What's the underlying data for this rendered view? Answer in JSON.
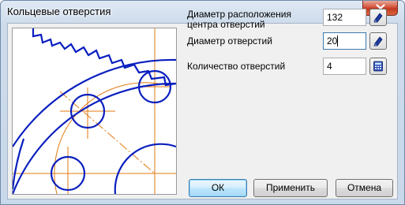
{
  "window": {
    "title": "Кольцевые отверстия"
  },
  "form": {
    "center_diameter_label": "Диаметр расположения центра отверстий",
    "center_diameter_value": "132",
    "hole_diameter_label": "Диаметр отверстий",
    "hole_diameter_value": "20",
    "hole_count_label": "Количество отверстий",
    "hole_count_value": "4"
  },
  "buttons": {
    "ok": "ОК",
    "apply": "Применить",
    "cancel": "Отмена"
  },
  "icons": {
    "close": "close-icon",
    "pick": "pick-from-drawing-icon",
    "calculator": "calculator-icon"
  },
  "colors": {
    "geometry": "#0a1fbf",
    "centerline": "#e07a10",
    "close_button": "#c94a30",
    "default_button_border": "#3c7fb1"
  }
}
